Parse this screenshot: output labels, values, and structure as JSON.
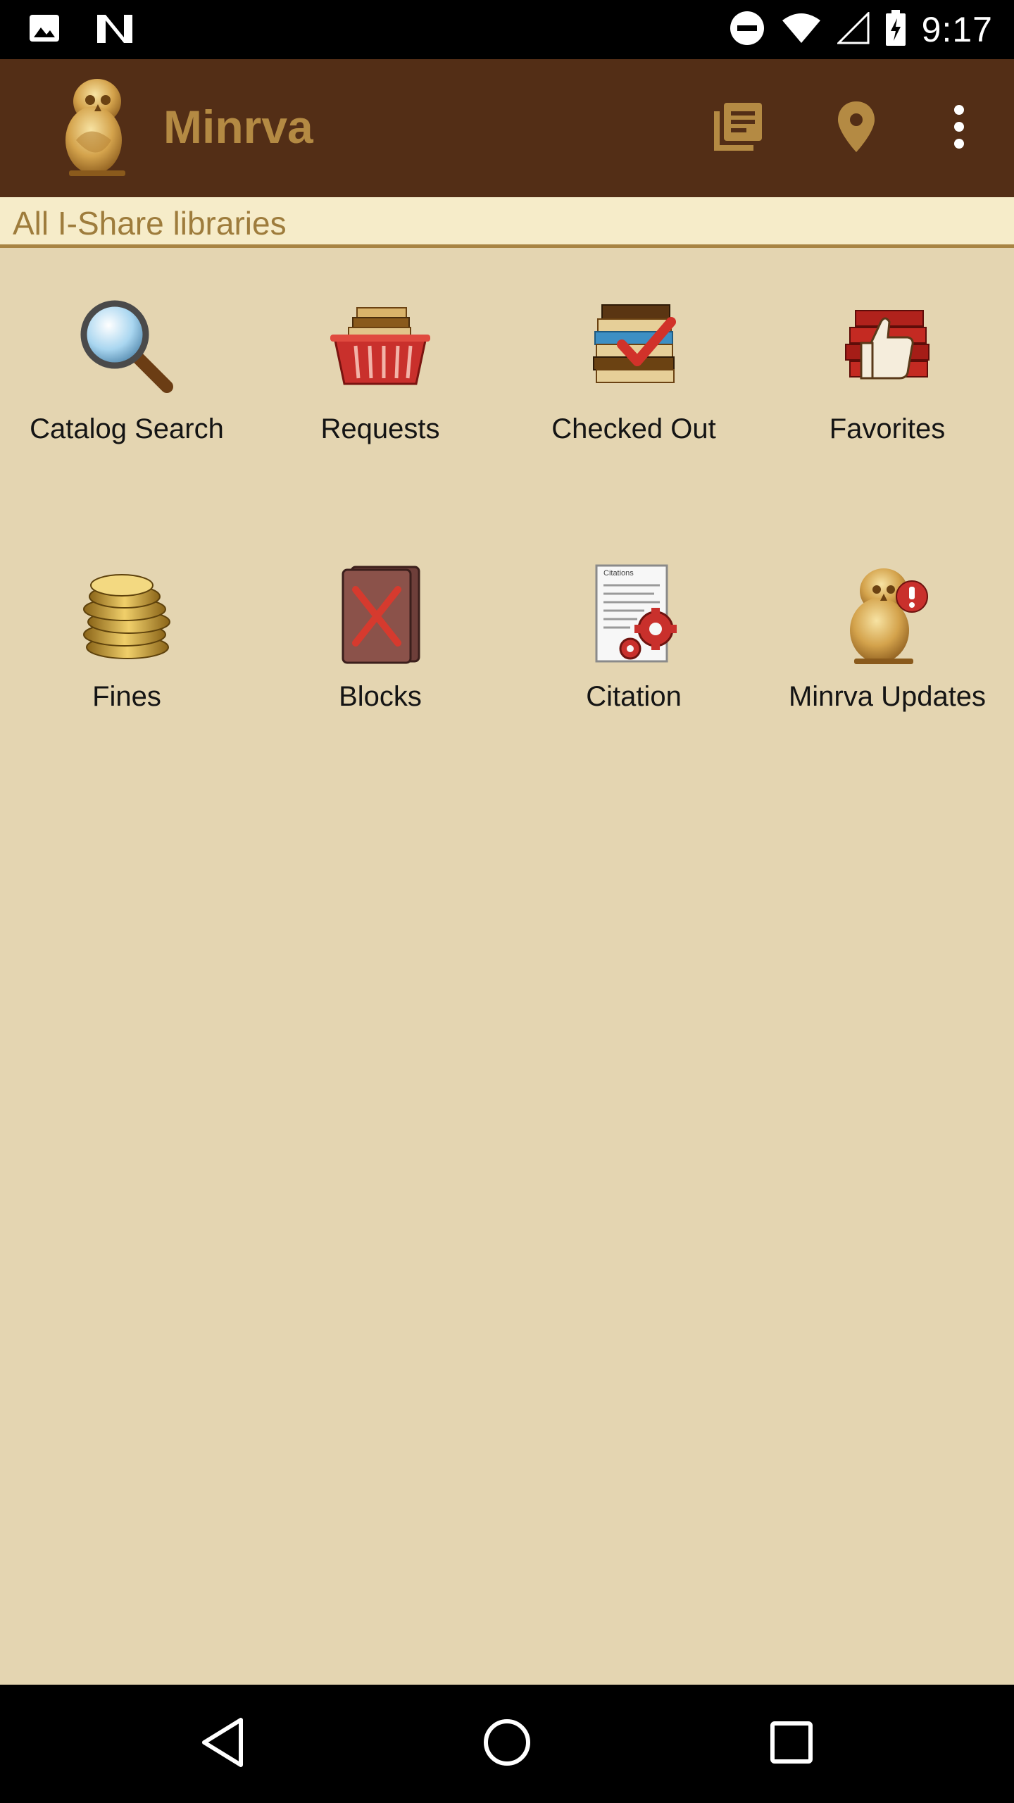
{
  "status_bar": {
    "time": "9:17",
    "left_icons": [
      "image-icon",
      "notification-n-icon"
    ],
    "right_icons": [
      "do-not-disturb-icon",
      "wifi-icon",
      "signal-icon",
      "battery-charging-icon"
    ]
  },
  "app_bar": {
    "title": "Minrva",
    "logo_icon": "owl-logo-icon",
    "actions": [
      "library-books-icon",
      "location-pin-icon",
      "more-vert-icon"
    ],
    "background": "#532e16",
    "title_color": "#b48a43"
  },
  "sub_header": {
    "text": "All I-Share libraries"
  },
  "tiles": [
    {
      "label": "Catalog Search",
      "icon": "magnifier-icon"
    },
    {
      "label": "Requests",
      "icon": "book-basket-icon"
    },
    {
      "label": "Checked Out",
      "icon": "books-checkmark-icon"
    },
    {
      "label": "Favorites",
      "icon": "thumbs-up-books-icon"
    },
    {
      "label": "Fines",
      "icon": "coins-icon"
    },
    {
      "label": "Blocks",
      "icon": "blocked-book-icon"
    },
    {
      "label": "Citation",
      "icon": "citation-gears-icon"
    },
    {
      "label": "Minrva Updates",
      "icon": "owl-alert-icon"
    }
  ],
  "citation_icon_caption": "Citations",
  "nav_bar": {
    "buttons": [
      "back-icon",
      "home-icon",
      "recents-icon"
    ]
  }
}
